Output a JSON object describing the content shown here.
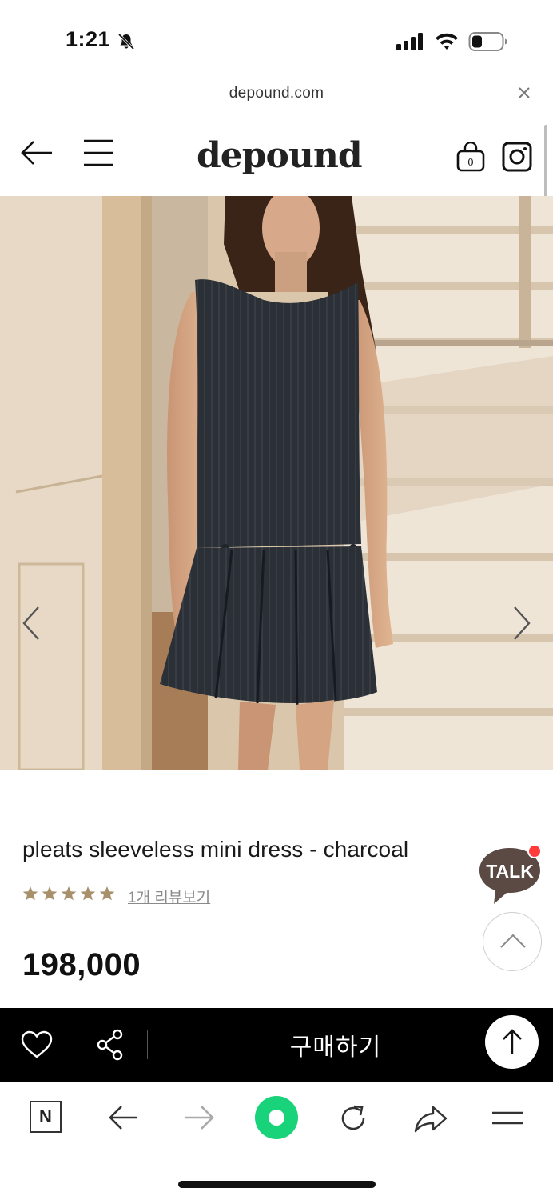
{
  "status_bar": {
    "time": "1:21",
    "icons": [
      "bell-off-icon",
      "cellular-signal-icon",
      "wifi-icon",
      "battery-icon"
    ]
  },
  "url_bar": {
    "url": "depound.com",
    "close_icon": "close-icon"
  },
  "header": {
    "logo": "depound",
    "back_icon": "arrow-left-icon",
    "menu_icon": "hamburger-menu-icon",
    "cart_icon": "shopping-bag-icon",
    "cart_count": "0",
    "instagram_icon": "instagram-icon"
  },
  "gallery": {
    "prev_icon": "chevron-left-icon",
    "next_icon": "chevron-right-icon"
  },
  "product": {
    "name": "pleats sleeveless mini dress - charcoal",
    "rating_stars": 5,
    "review_link": "1개 리뷰보기",
    "price": "198,000"
  },
  "floating": {
    "talk_label": "TALK",
    "scroll_top_icon": "chevron-up-icon"
  },
  "buy_bar": {
    "wishlist_icon": "heart-icon",
    "share_icon": "share-icon",
    "buy_label": "구매하기",
    "top_icon": "arrow-up-icon"
  },
  "browser_toolbar": {
    "naver_label": "N",
    "items": [
      "naver-home-icon",
      "arrow-left-icon",
      "arrow-right-icon",
      "green-dot-icon",
      "reload-icon",
      "share-arrow-icon",
      "menu-icon"
    ]
  },
  "colors": {
    "buy_bar_bg": "#000000",
    "star_color": "#a8906a",
    "talk_bubble": "#5a4a43",
    "talk_badge": "#ff3b3b",
    "green_button": "#19d37a"
  }
}
